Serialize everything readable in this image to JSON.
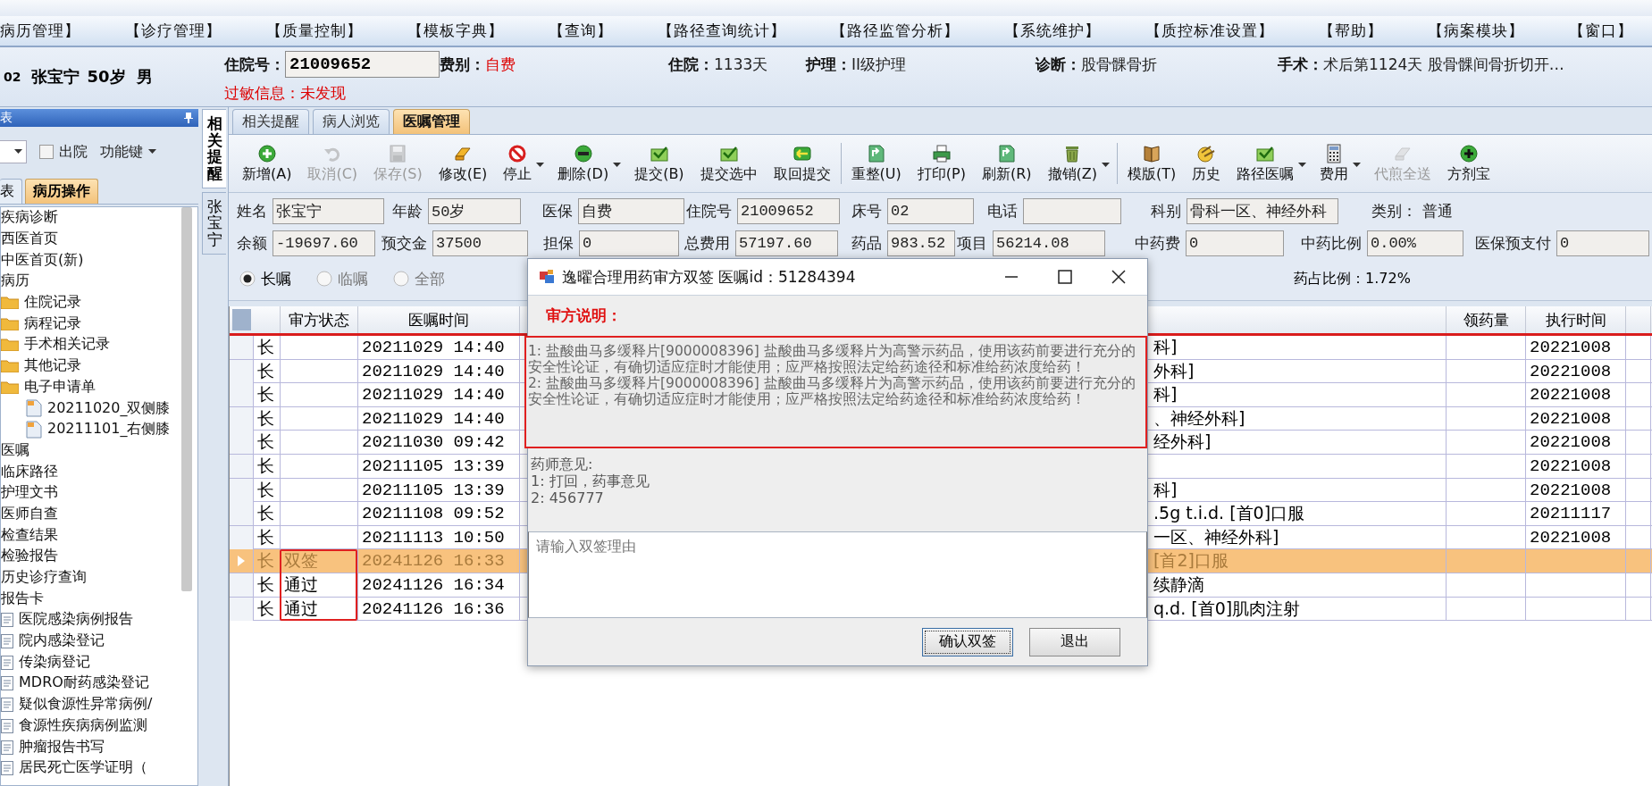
{
  "menu_bar": [
    "病历管理】",
    "【诊疗管理】",
    "【质量控制】",
    "【模板字典】",
    "【查询】",
    "【路径查询统计】",
    "【路径监管分析】",
    "【系统维护】",
    "【质控标准设置】",
    "【帮助】",
    "【病案模块】",
    "【窗口】"
  ],
  "patient_header": {
    "bed": "02",
    "name": "张宝宁",
    "age": "50岁",
    "sex": "男",
    "items": [
      {
        "label": "住院号：",
        "value": "21009652",
        "kind": "field"
      },
      {
        "label": "费别：",
        "value": "自费",
        "kind": "alert"
      },
      {
        "label": "住院：",
        "value": "1133天",
        "kind": "text"
      },
      {
        "label": "护理：",
        "value": "II级护理",
        "kind": "text"
      },
      {
        "label": "诊断：",
        "value": "股骨髁骨折",
        "kind": "text"
      },
      {
        "label": "手术：",
        "value": "术后第1124天   股骨髁间骨折切开…",
        "kind": "text"
      }
    ],
    "allergy": "过敏信息：未发现"
  },
  "left_panel": {
    "title": "表",
    "discharged": {
      "label": "出院",
      "checked": false
    },
    "function_keys": "功能键",
    "tabs": [
      {
        "label": "表",
        "selected": false
      },
      {
        "label": "病历操作",
        "selected": true
      }
    ],
    "tree": [
      {
        "label": "疾病诊断"
      },
      {
        "label": "西医首页"
      },
      {
        "label": "中医首页(新)"
      },
      {
        "label": "病历",
        "children": [
          {
            "label": "住院记录",
            "kind": "folder"
          },
          {
            "label": "病程记录",
            "kind": "folder"
          },
          {
            "label": "手术相关记录",
            "kind": "folder"
          },
          {
            "label": "其他记录",
            "kind": "folder"
          },
          {
            "label": "电子申请单",
            "kind": "folder",
            "children": [
              {
                "label": "20211020_双侧膝",
                "kind": "file"
              },
              {
                "label": "20211101_右侧膝",
                "kind": "file"
              }
            ]
          }
        ]
      },
      {
        "label": "医嘱"
      },
      {
        "label": "临床路径"
      },
      {
        "label": "护理文书"
      },
      {
        "label": "医师自查"
      },
      {
        "label": "检查结果"
      },
      {
        "label": "检验报告"
      },
      {
        "label": "历史诊疗查询"
      },
      {
        "label": "报告卡",
        "children": [
          {
            "label": "医院感染病例报告",
            "kind": "form"
          },
          {
            "label": "院内感染登记",
            "kind": "form"
          },
          {
            "label": "传染病登记",
            "kind": "form"
          },
          {
            "label": "MDRO耐药感染登记",
            "kind": "form"
          },
          {
            "label": "疑似食源性异常病例/",
            "kind": "form"
          },
          {
            "label": "食源性疾病病例监测",
            "kind": "form"
          },
          {
            "label": "肿瘤报告书写",
            "kind": "form"
          },
          {
            "label": "居民死亡医学证明（",
            "kind": "form"
          }
        ]
      }
    ]
  },
  "side_tabs": [
    {
      "label": "相关提醒",
      "selected": true
    },
    {
      "label": "张宝宁",
      "selected": false
    }
  ],
  "tabs": [
    {
      "label": "相关提醒",
      "selected": false
    },
    {
      "label": "病人浏览",
      "selected": false
    },
    {
      "label": "医嘱管理",
      "selected": true
    }
  ],
  "toolbar": [
    [
      {
        "label": "新增(A)",
        "disabled": false,
        "dropdown": false
      },
      {
        "label": "取消(C)",
        "disabled": true,
        "dropdown": false
      },
      {
        "label": "保存(S)",
        "disabled": true,
        "dropdown": false
      },
      {
        "label": "修改(E)",
        "disabled": false,
        "dropdown": false
      },
      {
        "label": "停止",
        "disabled": false,
        "dropdown": true
      },
      {
        "label": "删除(D)",
        "disabled": false,
        "dropdown": true
      },
      {
        "label": "提交(B)",
        "disabled": false,
        "dropdown": false
      },
      {
        "label": "提交选中",
        "disabled": false,
        "dropdown": false
      },
      {
        "label": "取回提交",
        "disabled": false,
        "dropdown": false
      }
    ],
    [
      {
        "label": "重整(U)",
        "disabled": false,
        "dropdown": false
      },
      {
        "label": "打印(P)",
        "disabled": false,
        "dropdown": false
      },
      {
        "label": "刷新(R)",
        "disabled": false,
        "dropdown": false
      },
      {
        "label": "撤销(Z)",
        "disabled": false,
        "dropdown": true
      }
    ],
    [
      {
        "label": "模版(T)",
        "disabled": false,
        "dropdown": false
      },
      {
        "label": "历史",
        "disabled": false,
        "dropdown": false
      },
      {
        "label": "路径医嘱",
        "disabled": false,
        "dropdown": true
      },
      {
        "label": "费用",
        "disabled": false,
        "dropdown": true
      },
      {
        "label": "代煎全送",
        "disabled": true,
        "dropdown": false
      },
      {
        "label": "方剂宝",
        "disabled": false,
        "dropdown": false
      }
    ]
  ],
  "patient_form": [
    [
      {
        "label": "姓名",
        "value": "张宝宁",
        "kind": "field"
      },
      {
        "label": "年龄",
        "value": "50岁",
        "kind": "field"
      },
      {
        "label": "医保",
        "value": "自费",
        "kind": "field"
      },
      {
        "label": "住院号",
        "value": "21009652",
        "kind": "field"
      },
      {
        "label": "床号",
        "value": "02",
        "kind": "field"
      },
      {
        "label": "电话",
        "kind": "field"
      },
      {
        "label": "科别",
        "value": "骨科一区、神经外科",
        "kind": "field"
      },
      {
        "label": "类别：",
        "value": "普通",
        "kind": "text"
      }
    ],
    [
      {
        "label": "余额",
        "value": "-19697.60",
        "kind": "field"
      },
      {
        "label": "预交金",
        "value": "37500",
        "kind": "field"
      },
      {
        "label": "担保",
        "value": "0",
        "kind": "field"
      },
      {
        "label": "总费用",
        "value": "57197.60",
        "kind": "field"
      },
      {
        "label": "药品",
        "value": "983.52",
        "kind": "field"
      },
      {
        "label": "项目",
        "value": "56214.08",
        "kind": "field"
      },
      {
        "label": "中药费",
        "value": "0",
        "kind": "field"
      },
      {
        "label": "中药比例",
        "value": "0.00%",
        "kind": "field"
      },
      {
        "label": "医保预支付",
        "value": "0",
        "kind": "field"
      }
    ]
  ],
  "order_filter": [
    {
      "label": "长嘱",
      "selected": true
    },
    {
      "label": "临嘱",
      "selected": false
    },
    {
      "label": "全部",
      "selected": false
    }
  ],
  "drug_ratio": "药占比例：1.72%",
  "table": {
    "columns": [
      "审方状态",
      "医嘱时间",
      "领药量",
      "执行时间"
    ],
    "rows": [
      {
        "selected": false,
        "type": "长",
        "order_time": "20211029 14:40",
        "content": "科]",
        "exec_time": "20221008"
      },
      {
        "selected": false,
        "type": "长",
        "order_time": "20211029 14:40",
        "content": "外科]",
        "exec_time": "20221008"
      },
      {
        "selected": false,
        "type": "长",
        "order_time": "20211029 14:40",
        "content": "科]",
        "exec_time": "20221008"
      },
      {
        "selected": false,
        "type": "长",
        "order_time": "20211029 14:40",
        "content": "、神经外科]",
        "exec_time": "20221008"
      },
      {
        "selected": false,
        "type": "长",
        "order_time": "20211030 09:42",
        "content": "经外科]",
        "exec_time": "20221008"
      },
      {
        "selected": false,
        "type": "长",
        "order_time": "20211105 13:39",
        "exec_time": "20221008"
      },
      {
        "selected": false,
        "type": "长",
        "order_time": "20211105 13:39",
        "content": "科]",
        "exec_time": "20221008"
      },
      {
        "selected": false,
        "type": "长",
        "order_time": "20211108 09:52",
        "content": ".5g t.i.d. [首0]口服",
        "exec_time": "20211117"
      },
      {
        "selected": false,
        "type": "长",
        "order_time": "20211113 10:50",
        "content": "一区、神经外科]",
        "exec_time": "20221008"
      },
      {
        "selected": true,
        "type": "长",
        "review_status": "双签",
        "order_time": "20241126 16:33",
        "content": "[首2]口服"
      },
      {
        "selected": false,
        "type": "长",
        "review_status": "通过",
        "order_time": "20241126 16:34",
        "content": "续静滴"
      },
      {
        "selected": false,
        "type": "长",
        "review_status": "通过",
        "order_time": "20241126 16:36",
        "content": "q.d. [首0]肌肉注射"
      }
    ]
  },
  "dialog": {
    "title": "逸曜合理用药审方双签 医嘱id：51284394",
    "section_title": "审方说明：",
    "review_notes": [
      "1: 盐酸曲马多缓释片[9000008396] 盐酸曲马多缓释片为高警示药品，使用该药前要进行充分的安全性论证，有确切适应症时才能使用；应严格按照法定给药途径和标准给药浓度给药！",
      "2: 盐酸曲马多缓释片[9000008396] 盐酸曲马多缓释片为高警示药品，使用该药前要进行充分的安全性论证，有确切适应症时才能使用；应严格按照法定给药途径和标准给药浓度给药！"
    ],
    "pharmacist_title": "药师意见:",
    "pharmacist_opinions": [
      "1: 打回，药事意见",
      "2: 456777"
    ],
    "reason_placeholder": "请输入双签理由",
    "buttons": [
      "确认双签",
      "退出"
    ]
  }
}
